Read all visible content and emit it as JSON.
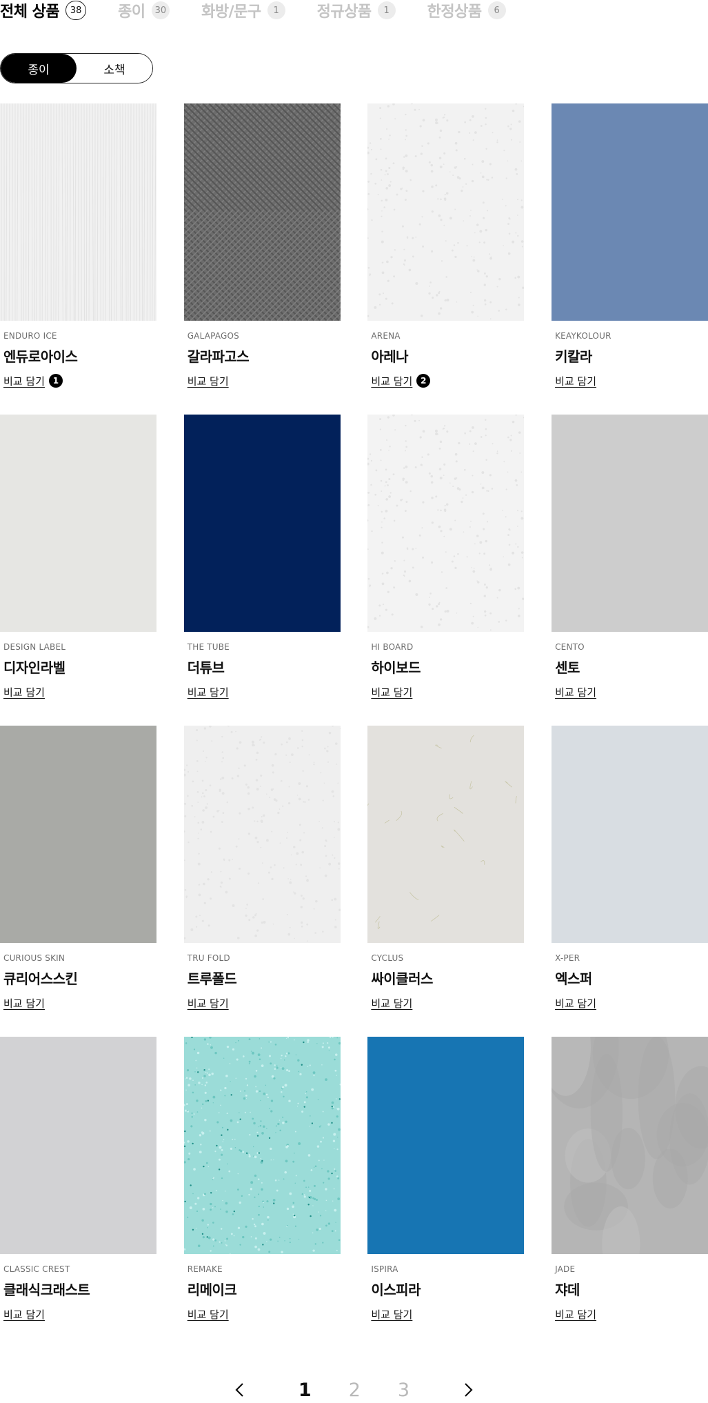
{
  "tabs": [
    {
      "label": "전체 상품",
      "count": "38",
      "active": true
    },
    {
      "label": "종이",
      "count": "30",
      "active": false
    },
    {
      "label": "화방/문구",
      "count": "1",
      "active": false
    },
    {
      "label": "정규상품",
      "count": "1",
      "active": false
    },
    {
      "label": "한정상품",
      "count": "6",
      "active": false
    }
  ],
  "toggle": {
    "paper": "종이",
    "booklet": "소책",
    "selected": "종이"
  },
  "compare_label": "비교 담기",
  "products": [
    {
      "en": "ENDURO ICE",
      "ko": "엔듀로아이스",
      "color": "#f1f1f1",
      "texture": "vertical",
      "badge": "1"
    },
    {
      "en": "GALAPAGOS",
      "ko": "갈라파고스",
      "color": "#6c6c6c",
      "texture": "crosshatch",
      "badge": ""
    },
    {
      "en": "ARENA",
      "ko": "아레나",
      "color": "#f2f2f2",
      "texture": "grain",
      "badge": "2"
    },
    {
      "en": "KEAYKOLOUR",
      "ko": "키칼라",
      "color": "#6b88b3",
      "texture": "none",
      "badge": ""
    },
    {
      "en": "DESIGN LABEL",
      "ko": "디자인라벨",
      "color": "#e6e6e3",
      "texture": "none",
      "badge": ""
    },
    {
      "en": "THE TUBE",
      "ko": "더튜브",
      "color": "#02215a",
      "texture": "none",
      "badge": ""
    },
    {
      "en": "HI BOARD",
      "ko": "하이보드",
      "color": "#f3f3f3",
      "texture": "grain",
      "badge": ""
    },
    {
      "en": "CENTO",
      "ko": "센토",
      "color": "#cdcdcd",
      "texture": "none",
      "badge": ""
    },
    {
      "en": "CURIOUS SKIN",
      "ko": "큐리어스스킨",
      "color": "#a9aaa6",
      "texture": "none",
      "badge": ""
    },
    {
      "en": "TRU FOLD",
      "ko": "트루폴드",
      "color": "#efefef",
      "texture": "grain",
      "badge": ""
    },
    {
      "en": "CYCLUS",
      "ko": "싸이클러스",
      "color": "#e3e1dd",
      "texture": "fiber",
      "badge": ""
    },
    {
      "en": "X-PER",
      "ko": "엑스퍼",
      "color": "#d8dde2",
      "texture": "none",
      "badge": ""
    },
    {
      "en": "CLASSIC CREST",
      "ko": "클래식크래스트",
      "color": "#d2d2d4",
      "texture": "none",
      "badge": ""
    },
    {
      "en": "REMAKE",
      "ko": "리메이크",
      "color": "#9bdcd8",
      "texture": "speckle",
      "badge": ""
    },
    {
      "en": "ISPIRA",
      "ko": "이스피라",
      "color": "#1775b3",
      "texture": "none",
      "badge": ""
    },
    {
      "en": "JADE",
      "ko": "쟈데",
      "color": "#b5b5b5",
      "texture": "mottled",
      "badge": ""
    }
  ],
  "pagination": {
    "pages": [
      "1",
      "2",
      "3"
    ],
    "current": "1",
    "prev_icon": "chevron-left-icon",
    "next_icon": "chevron-right-icon"
  }
}
